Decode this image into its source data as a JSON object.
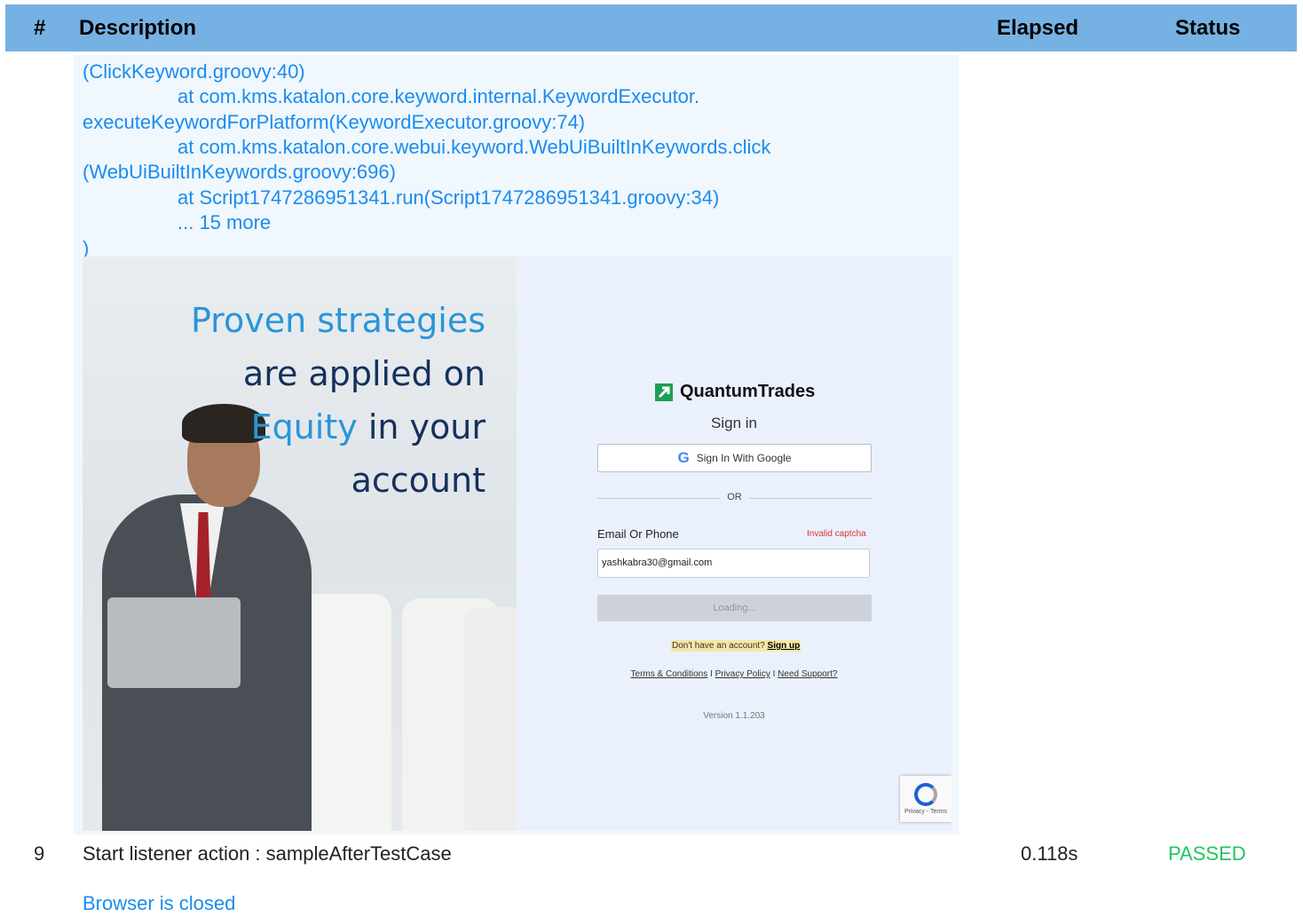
{
  "header": {
    "num": "#",
    "description": "Description",
    "elapsed": "Elapsed",
    "status": "Status"
  },
  "trace_lines": [
    "(ClickKeyword.groovy:40)",
    "at com.kms.katalon.core.keyword.internal.KeywordExecutor.",
    "executeKeywordForPlatform(KeywordExecutor.groovy:74)",
    "at com.kms.katalon.core.webui.keyword.WebUiBuiltInKeywords.click",
    "(WebUiBuiltInKeywords.groovy:696)",
    "at Script1747286951341.run(Script1747286951341.groovy:34)",
    "... 15 more",
    ")"
  ],
  "screenshot": {
    "hero": {
      "line1": "Proven strategies",
      "line2": "are applied on",
      "line3_blue": "Equity",
      "line3_rest": " in your",
      "line4": "account"
    },
    "brand": "QuantumTrades",
    "signin_title": "Sign in",
    "google_button": "Sign In With Google",
    "or_text": "OR",
    "email_label": "Email Or Phone",
    "error_text": "Invalid captcha",
    "email_value": "yashkabra30@gmail.com",
    "submit_label": "Loading...",
    "no_account_text": "Don't have an account?",
    "signup_link": "Sign up",
    "links": {
      "terms": "Terms & Conditions",
      "sep": "I",
      "privacy": "Privacy Policy",
      "support": "Need Support?"
    },
    "version": "Version 1.1.203",
    "captcha_text": "Privacy - Terms"
  },
  "step": {
    "num": "9",
    "description": "Start listener action : sampleAfterTestCase",
    "elapsed": "0.118s",
    "status": "PASSED"
  },
  "log_message": "Browser is closed",
  "colors": {
    "header_bg": "#76b1e4",
    "log_text": "#1a8cf0",
    "passed": "#22c55e",
    "trace_bg": "#f0f7fd"
  }
}
